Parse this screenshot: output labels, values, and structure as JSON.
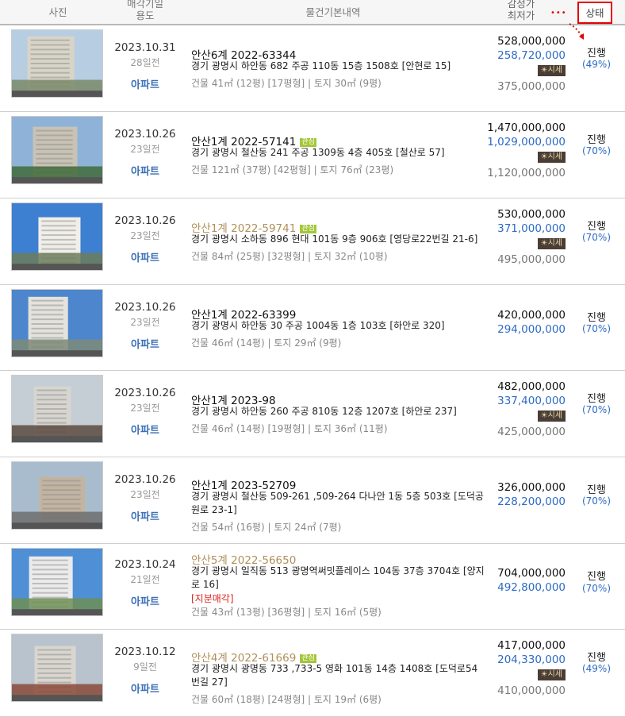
{
  "header": {
    "photo": "사진",
    "date_line1": "매각기일",
    "date_line2": "용도",
    "info": "물건기본내역",
    "price_line1": "감정가",
    "price_line2": "최저가",
    "status": "상태",
    "dots": "•••"
  },
  "sise_label": "시세",
  "interest_badge": "관심",
  "items": [
    {
      "date": "2023.10.31",
      "days": "28일전",
      "type": "아파트",
      "case": "안산6계 2022-63344",
      "interest": false,
      "addr": "경기 광명시 하안동 682 주공 110동 15층 1508호 [안현로 15]",
      "extra": "",
      "area": "건물 41㎡ (12평) [17평형]  |  토지 30㎡ (9평)",
      "appraisal": "528,000,000",
      "minimum": "258,720,000",
      "market": "375,000,000",
      "status": "진행",
      "percent": "(49%)"
    },
    {
      "date": "2023.10.26",
      "days": "23일전",
      "type": "아파트",
      "case": "안산1계 2022-57141",
      "interest": true,
      "addr": "경기 광명시 철산동 241 주공 1309동 4층 405호 [철산로 57]",
      "extra": "",
      "area": "건물 121㎡ (37평) [42평형]  |  토지 76㎡ (23평)",
      "appraisal": "1,470,000,000",
      "minimum": "1,029,000,000",
      "market": "1,120,000,000",
      "status": "진행",
      "percent": "(70%)"
    },
    {
      "date": "2023.10.26",
      "days": "23일전",
      "type": "아파트",
      "case": "안산1계 2022-59741",
      "interest": true,
      "addr": "경기 광명시 소하동 896 현대 101동 9층 906호 [영당로22번길 21-6]",
      "extra": "",
      "area": "건물 84㎡ (25평) [32평형]  |  토지 32㎡ (10평)",
      "appraisal": "530,000,000",
      "minimum": "371,000,000",
      "market": "495,000,000",
      "status": "진행",
      "percent": "(70%)"
    },
    {
      "date": "2023.10.26",
      "days": "23일전",
      "type": "아파트",
      "case": "안산1계 2022-63399",
      "interest": false,
      "addr": "경기 광명시 하안동 30 주공 1004동 1층 103호 [하안로 320]",
      "extra": "",
      "area": "건물 46㎡ (14평)  |  토지 29㎡ (9평)",
      "appraisal": "420,000,000",
      "minimum": "294,000,000",
      "market": "",
      "status": "진행",
      "percent": "(70%)"
    },
    {
      "date": "2023.10.26",
      "days": "23일전",
      "type": "아파트",
      "case": "안산1계 2023-98",
      "interest": false,
      "addr": "경기 광명시 하안동 260 주공 810동 12층 1207호 [하안로 237]",
      "extra": "",
      "area": "건물 46㎡ (14평) [19평형]  |  토지 36㎡ (11평)",
      "appraisal": "482,000,000",
      "minimum": "337,400,000",
      "market": "425,000,000",
      "status": "진행",
      "percent": "(70%)"
    },
    {
      "date": "2023.10.26",
      "days": "23일전",
      "type": "아파트",
      "case": "안산1계 2023-52709",
      "interest": false,
      "addr": "경기 광명시 철산동 509-261 ,509-264 다나안 1동 5층 503호 [도덕공원로 23-1]",
      "extra": "",
      "area": "건물 54㎡ (16평)  |  토지 24㎡ (7평)",
      "appraisal": "326,000,000",
      "minimum": "228,200,000",
      "market": "",
      "status": "진행",
      "percent": "(70%)"
    },
    {
      "date": "2023.10.24",
      "days": "21일전",
      "type": "아파트",
      "case": "안산5계 2022-56650",
      "interest": false,
      "addr": "경기 광명시 일직동 513 광명역써밋플레이스 104동 37층 3704호 [양지로 16]",
      "extra": "[지분매각]",
      "area": "건물 43㎡ (13평) [36평형]  |  토지 16㎡ (5평)",
      "appraisal": "704,000,000",
      "minimum": "492,800,000",
      "market": "",
      "status": "진행",
      "percent": "(70%)"
    },
    {
      "date": "2023.10.12",
      "days": "9일전",
      "type": "아파트",
      "case": "안산4계 2022-61669",
      "interest": true,
      "addr": "경기 광명시 광명동 733 ,733-5 영화 101동 14층 1408호 [도덕로54번길 27]",
      "extra": "",
      "area": "건물 60㎡ (18평) [24평형]  |  토지 19㎡ (6평)",
      "appraisal": "417,000,000",
      "minimum": "204,330,000",
      "market": "410,000,000",
      "status": "진행",
      "percent": "(49%)"
    }
  ]
}
